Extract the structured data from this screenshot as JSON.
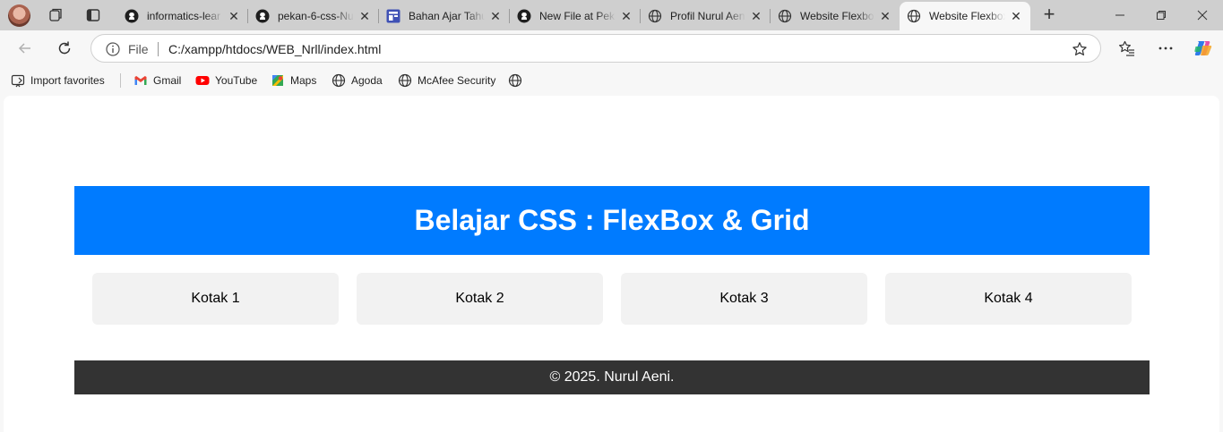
{
  "browser": {
    "tabs": [
      {
        "title": "informatics-lear",
        "favicon": "github-icon",
        "active": false
      },
      {
        "title": "pekan-6-css-Nu",
        "favicon": "github-icon",
        "active": false
      },
      {
        "title": "Bahan Ajar Tahu",
        "favicon": "doc-icon",
        "active": false
      },
      {
        "title": "New File at Pek",
        "favicon": "github-icon",
        "active": false
      },
      {
        "title": "Profil Nurul Aen",
        "favicon": "globe-icon",
        "active": false
      },
      {
        "title": "Website Flexbox",
        "favicon": "globe-icon",
        "active": false
      },
      {
        "title": "Website Flexbox",
        "favicon": "globe-icon",
        "active": true
      }
    ],
    "address": {
      "scheme_label": "File",
      "url": "C:/xampp/htdocs/WEB_Nrll/index.html"
    },
    "favorites": [
      {
        "label": "Import favorites",
        "icon": "import-icon"
      },
      {
        "label": "Gmail",
        "icon": "gmail-icon"
      },
      {
        "label": "YouTube",
        "icon": "youtube-icon"
      },
      {
        "label": "Maps",
        "icon": "maps-icon"
      },
      {
        "label": "Agoda",
        "icon": "globe-icon"
      },
      {
        "label": "McAfee Security",
        "icon": "globe-icon"
      },
      {
        "label": "",
        "icon": "globe-icon"
      }
    ]
  },
  "page": {
    "header_title": "Belajar CSS : FlexBox & Grid",
    "boxes": [
      "Kotak 1",
      "Kotak 2",
      "Kotak 3",
      "Kotak 4"
    ],
    "footer_text": "© 2025. Nurul Aeni."
  },
  "colors": {
    "header_bg": "#007bff",
    "box_bg": "#f2f2f2",
    "footer_bg": "#333333"
  }
}
